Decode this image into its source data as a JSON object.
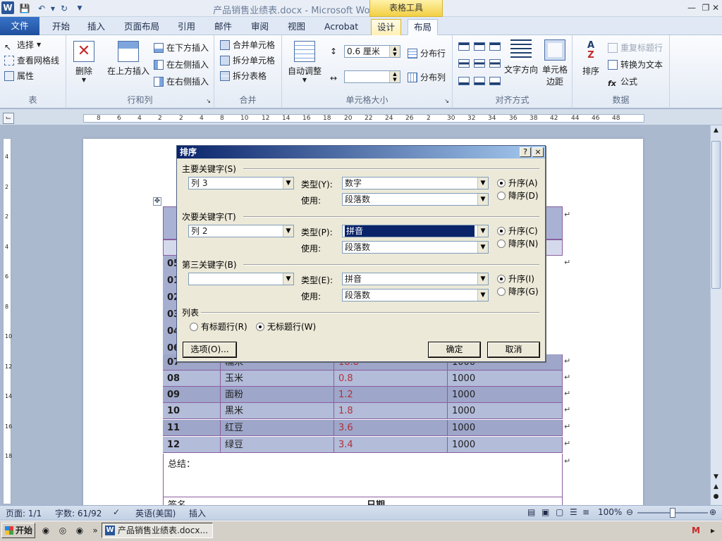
{
  "title_bar": {
    "app_letter": "W",
    "doc_title": "产品销售业绩表.docx - Microsoft Word",
    "context_group": "表格工具"
  },
  "ribbon_tabs": [
    "文件",
    "开始",
    "插入",
    "页面布局",
    "引用",
    "邮件",
    "审阅",
    "视图",
    "Acrobat",
    "设计",
    "布局"
  ],
  "ribbon": {
    "table_group": {
      "label": "表",
      "select": "选择",
      "gridlines": "查看网格线",
      "properties": "属性"
    },
    "rows_cols_group": {
      "label": "行和列",
      "delete": "删除",
      "insert_above": "在上方插入",
      "insert_below": "在下方插入",
      "insert_left": "在左侧插入",
      "insert_right": "在右侧插入"
    },
    "merge_group": {
      "label": "合并",
      "merge_cells": "合并单元格",
      "split_cells": "拆分单元格",
      "split_table": "拆分表格"
    },
    "cell_size_group": {
      "label": "单元格大小",
      "autofit": "自动调整",
      "height_value": "0.6 厘米",
      "width_value": "",
      "distribute_rows": "分布行",
      "distribute_cols": "分布列"
    },
    "alignment_group": {
      "label": "对齐方式",
      "text_direction": "文字方向",
      "cell_margins_line1": "单元格",
      "cell_margins_line2": "边距"
    },
    "data_group": {
      "label": "数据",
      "sort": "排序",
      "repeat_header": "重复标题行",
      "convert_text": "转换为文本",
      "formula": "公式"
    }
  },
  "ruler_numbers": [
    "8",
    "6",
    "4",
    "2",
    "2",
    "4",
    "8",
    "10",
    "12",
    "14",
    "16",
    "18",
    "20",
    "22",
    "24",
    "26",
    "2",
    "30",
    "32",
    "34",
    "36",
    "38",
    "42",
    "44",
    "46",
    "48"
  ],
  "vruler_numbers": [
    "4",
    "2",
    "2",
    "4",
    "6",
    "8",
    "10",
    "12",
    "14",
    "16",
    "18"
  ],
  "table_rows": [
    {
      "id": "07",
      "name": "糯米",
      "value": "18.8",
      "qty": "1000"
    },
    {
      "id": "08",
      "name": "玉米",
      "value": "0.8",
      "qty": "1000"
    },
    {
      "id": "09",
      "name": "面粉",
      "value": "1.2",
      "qty": "1000"
    },
    {
      "id": "10",
      "name": "黑米",
      "value": "1.8",
      "qty": "1000"
    },
    {
      "id": "11",
      "name": "红豆",
      "value": "3.6",
      "qty": "1000"
    },
    {
      "id": "12",
      "name": "绿豆",
      "value": "3.4",
      "qty": "1000"
    }
  ],
  "hidden_row_ids": [
    "05",
    "01",
    "02",
    "03",
    "04",
    "06"
  ],
  "summary_label": "总结：",
  "footer_row": {
    "sign_label": "签名",
    "date_label": "日期"
  },
  "dialog": {
    "title": "排序",
    "help": "?",
    "close": "×",
    "primary": {
      "section": "主要关键字(S)",
      "column": "列 3",
      "type_label": "类型(Y):",
      "type_value": "数字",
      "use_label": "使用:",
      "use_value": "段落数",
      "asc": "升序(A)",
      "desc": "降序(D)"
    },
    "secondary": {
      "section": "次要关键字(T)",
      "column": "列 2",
      "type_label": "类型(P):",
      "type_value": "拼音",
      "use_label": "使用:",
      "use_value": "段落数",
      "asc": "升序(C)",
      "desc": "降序(N)"
    },
    "third": {
      "section": "第三关键字(B)",
      "column": "",
      "type_label": "类型(E):",
      "type_value": "拼音",
      "use_label": "使用:",
      "use_value": "段落数",
      "asc": "升序(I)",
      "desc": "降序(G)"
    },
    "list": {
      "section": "列表",
      "with_header": "有标题行(R)",
      "no_header": "无标题行(W)"
    },
    "options_btn": "选项(O)...",
    "ok_btn": "确定",
    "cancel_btn": "取消"
  },
  "status_bar": {
    "page": "页面: 1/1",
    "words": "字数: 61/92",
    "language": "英语(美国)",
    "mode": "插入",
    "zoom": "100%"
  },
  "taskbar": {
    "start": "开始",
    "word_task": "产品销售业绩表.docx..."
  },
  "colors": {
    "ribbon_file_tab": "#2a5ba8",
    "dialog_title_start": "#0a246a",
    "row_dark": "#9ea6c9",
    "row_light": "#b3bcd9",
    "value_text": "#b0323a"
  }
}
